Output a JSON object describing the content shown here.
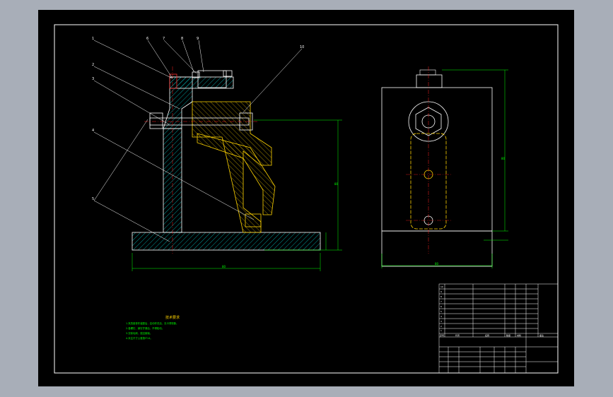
{
  "colors": {
    "background": "#a8aeb8",
    "canvas": "#000000",
    "border": "#ffffff",
    "body_hatch": "#00c0c0",
    "part_outline": "#ffd400",
    "dimension": "#00ff00",
    "centerline": "#ff2020",
    "leader": "#ffffff"
  },
  "balloons": [
    "1",
    "2",
    "3",
    "4",
    "5",
    "6",
    "7",
    "8",
    "9",
    "10"
  ],
  "dimensions": {
    "total_height": "80",
    "base_length": "80",
    "side_width": "80",
    "side_height": "80"
  },
  "notes": {
    "title": "技术要求",
    "lines": [
      "1.夹具各零件装配后，应动作灵活，无卡滞现象。",
      "2.各螺钉、销钉拧紧后，不得松动。",
      "3.去除毛刺，锐边倒钝。",
      "4.未注尺寸公差按IT14。"
    ]
  },
  "title_block": {
    "parts_rows": [
      "10",
      "9",
      "8",
      "7",
      "6",
      "5",
      "4",
      "3",
      "2",
      "1"
    ],
    "header_labels": [
      "序号",
      "代号",
      "名称",
      "数量",
      "材料",
      "备注"
    ]
  }
}
